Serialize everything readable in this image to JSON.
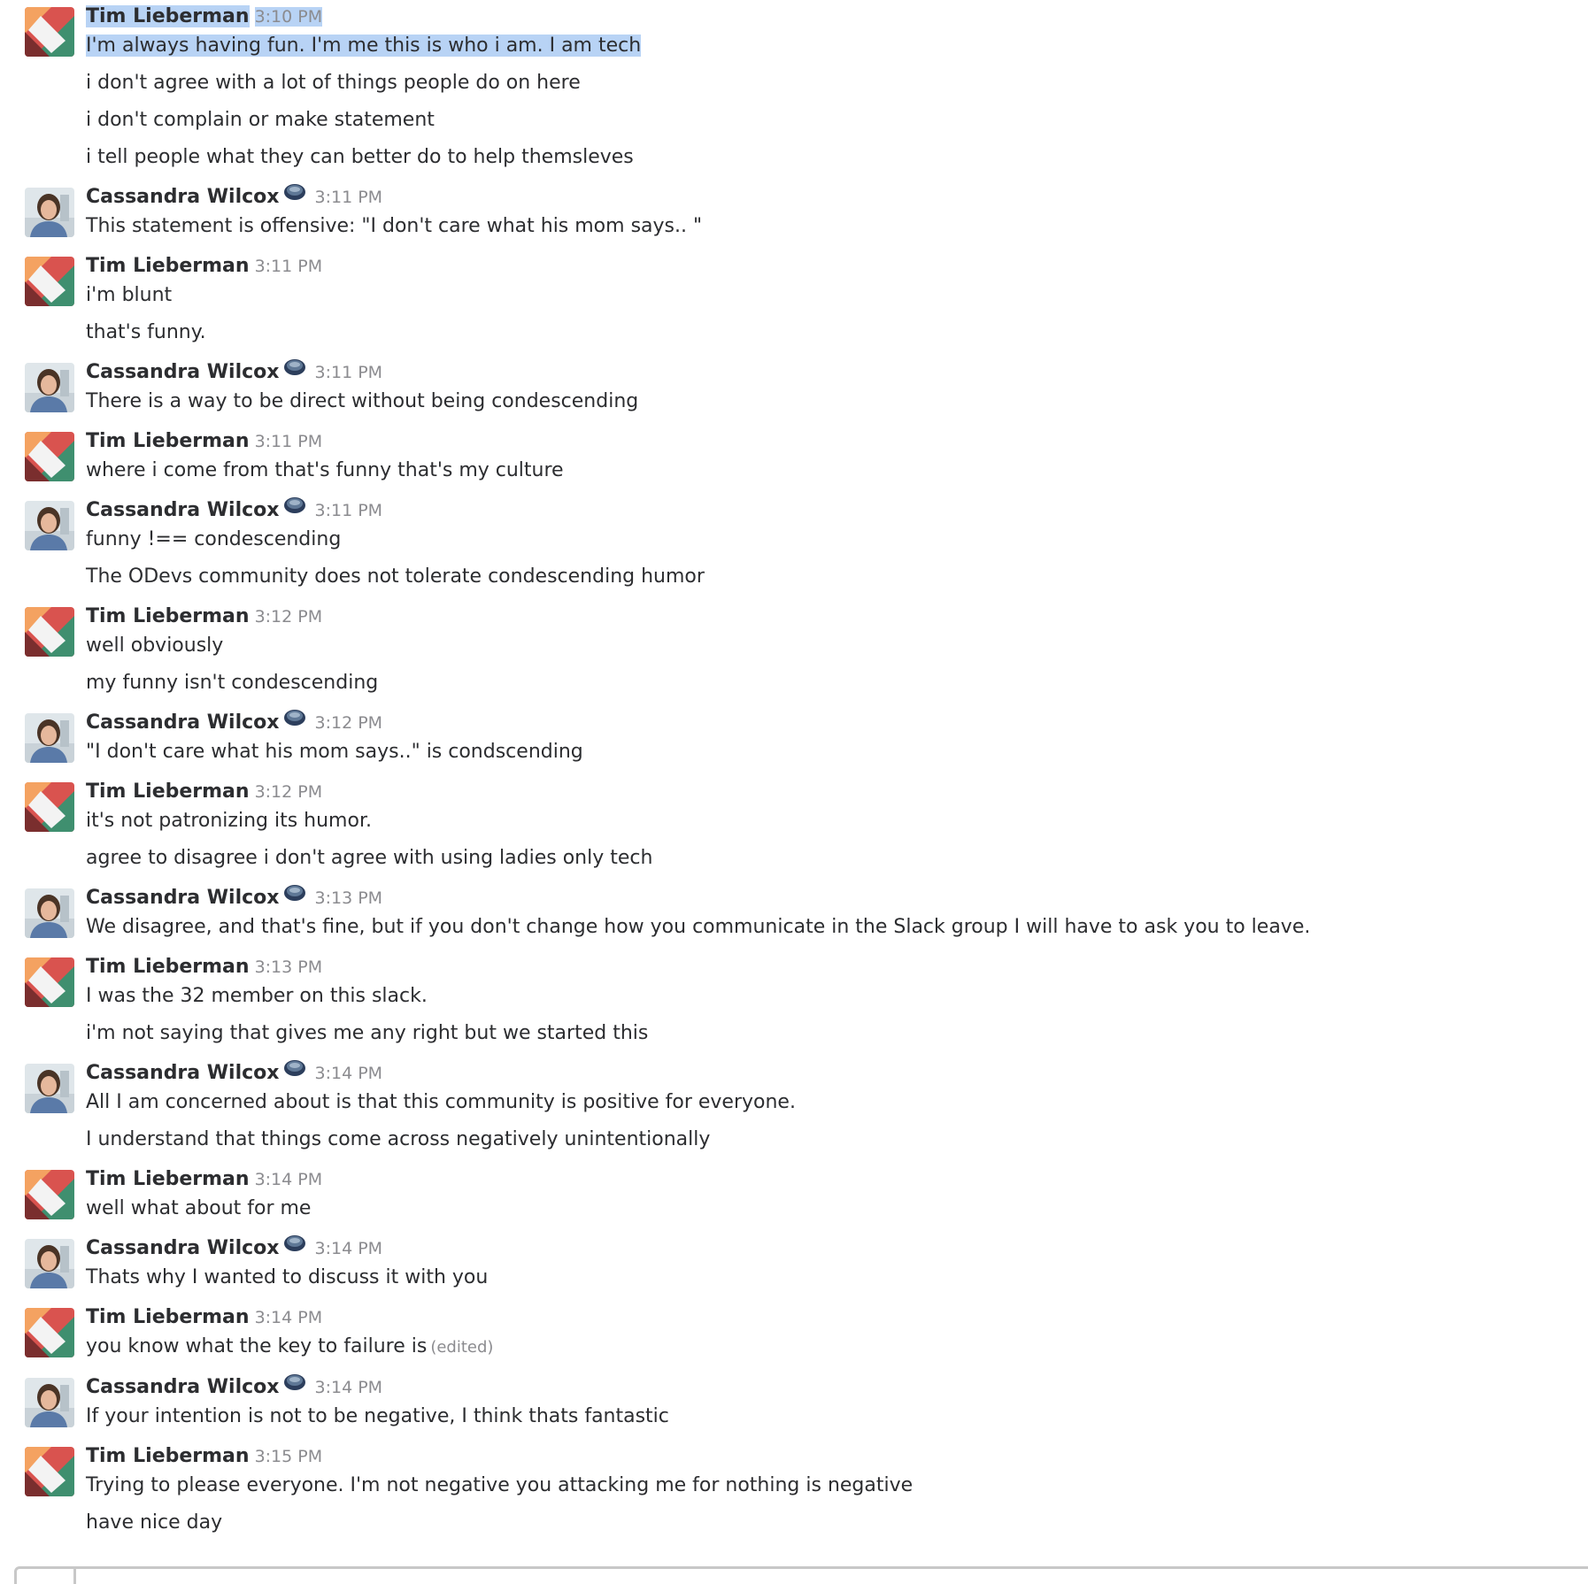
{
  "messages": [
    {
      "author": "Tim Lieberman",
      "time": "3:10 PM",
      "badge": false,
      "lines": [
        "I'm always having fun.  I'm me this is who i am.  I am tech",
        "i don't agree with a lot of things people do on here",
        "i don't complain or make statement",
        "i tell people what they can better do to help themsleves"
      ]
    },
    {
      "author": "Cassandra Wilcox",
      "time": "3:11 PM",
      "badge": true,
      "lines": [
        "This statement is offensive: \"I don't care what his mom says.. \""
      ]
    },
    {
      "author": "Tim Lieberman",
      "time": "3:11 PM",
      "badge": false,
      "lines": [
        "i'm blunt",
        "that's funny."
      ]
    },
    {
      "author": "Cassandra Wilcox",
      "time": "3:11 PM",
      "badge": true,
      "lines": [
        "There is a way to be direct without being condescending"
      ]
    },
    {
      "author": "Tim Lieberman",
      "time": "3:11 PM",
      "badge": false,
      "lines": [
        "where i come from that's funny that's my culture"
      ]
    },
    {
      "author": "Cassandra Wilcox",
      "time": "3:11 PM",
      "badge": true,
      "lines": [
        "funny !== condescending",
        "The ODevs community does not tolerate condescending humor"
      ]
    },
    {
      "author": "Tim Lieberman",
      "time": "3:12 PM",
      "badge": false,
      "lines": [
        "well obviously",
        "my funny isn't condescending"
      ]
    },
    {
      "author": "Cassandra Wilcox",
      "time": "3:12 PM",
      "badge": true,
      "lines": [
        "\"I don't care what his mom says..\" is condscending"
      ]
    },
    {
      "author": "Tim Lieberman",
      "time": "3:12 PM",
      "badge": false,
      "lines": [
        "it's not patronizing its humor.",
        "agree to disagree i don't agree with using ladies only tech"
      ]
    },
    {
      "author": "Cassandra Wilcox",
      "time": "3:13 PM",
      "badge": true,
      "lines": [
        "We disagree, and that's fine, but if you don't change how you communicate in the Slack group I will have to ask you to leave."
      ]
    },
    {
      "author": "Tim Lieberman",
      "time": "3:13 PM",
      "badge": false,
      "lines": [
        "I was the 32 member on this slack.",
        "i'm not saying that gives me any right but we started this"
      ]
    },
    {
      "author": "Cassandra Wilcox",
      "time": "3:14 PM",
      "badge": true,
      "lines": [
        "All I am concerned about is that this community is positive for everyone.",
        "I understand that things come across negatively unintentionally"
      ]
    },
    {
      "author": "Tim Lieberman",
      "time": "3:14 PM",
      "badge": false,
      "lines": [
        "well what about for me"
      ]
    },
    {
      "author": "Cassandra Wilcox",
      "time": "3:14 PM",
      "badge": true,
      "lines": [
        "Thats why I wanted to discuss it with you"
      ]
    },
    {
      "author": "Tim Lieberman",
      "time": "3:14 PM",
      "badge": false,
      "lines": [
        "you know what the key to failure is"
      ],
      "edited": "(edited)"
    },
    {
      "author": "Cassandra Wilcox",
      "time": "3:14 PM",
      "badge": true,
      "lines": [
        "If your intention is not to be negative, I think thats fantastic"
      ]
    },
    {
      "author": "Tim Lieberman",
      "time": "3:15 PM",
      "badge": false,
      "lines": [
        "Trying to please everyone.  I'm not negative you attacking me for nothing is negative",
        "have nice day"
      ]
    }
  ],
  "colors": {
    "selection": "#b8d3f5",
    "timestamp": "#8b8b8f",
    "author": "#2c2d30",
    "avatar_orange": "#f4a261",
    "avatar_red": "#d9534f",
    "avatar_maroon": "#7a2e2e",
    "avatar_green": "#3f8f6f",
    "badge_navy": "#2c3e5c"
  },
  "icons": {
    "tim_avatar": "geometric-avatar-icon",
    "cassandra_avatar": "photo-avatar-icon",
    "status_badge": "status-badge-icon"
  }
}
